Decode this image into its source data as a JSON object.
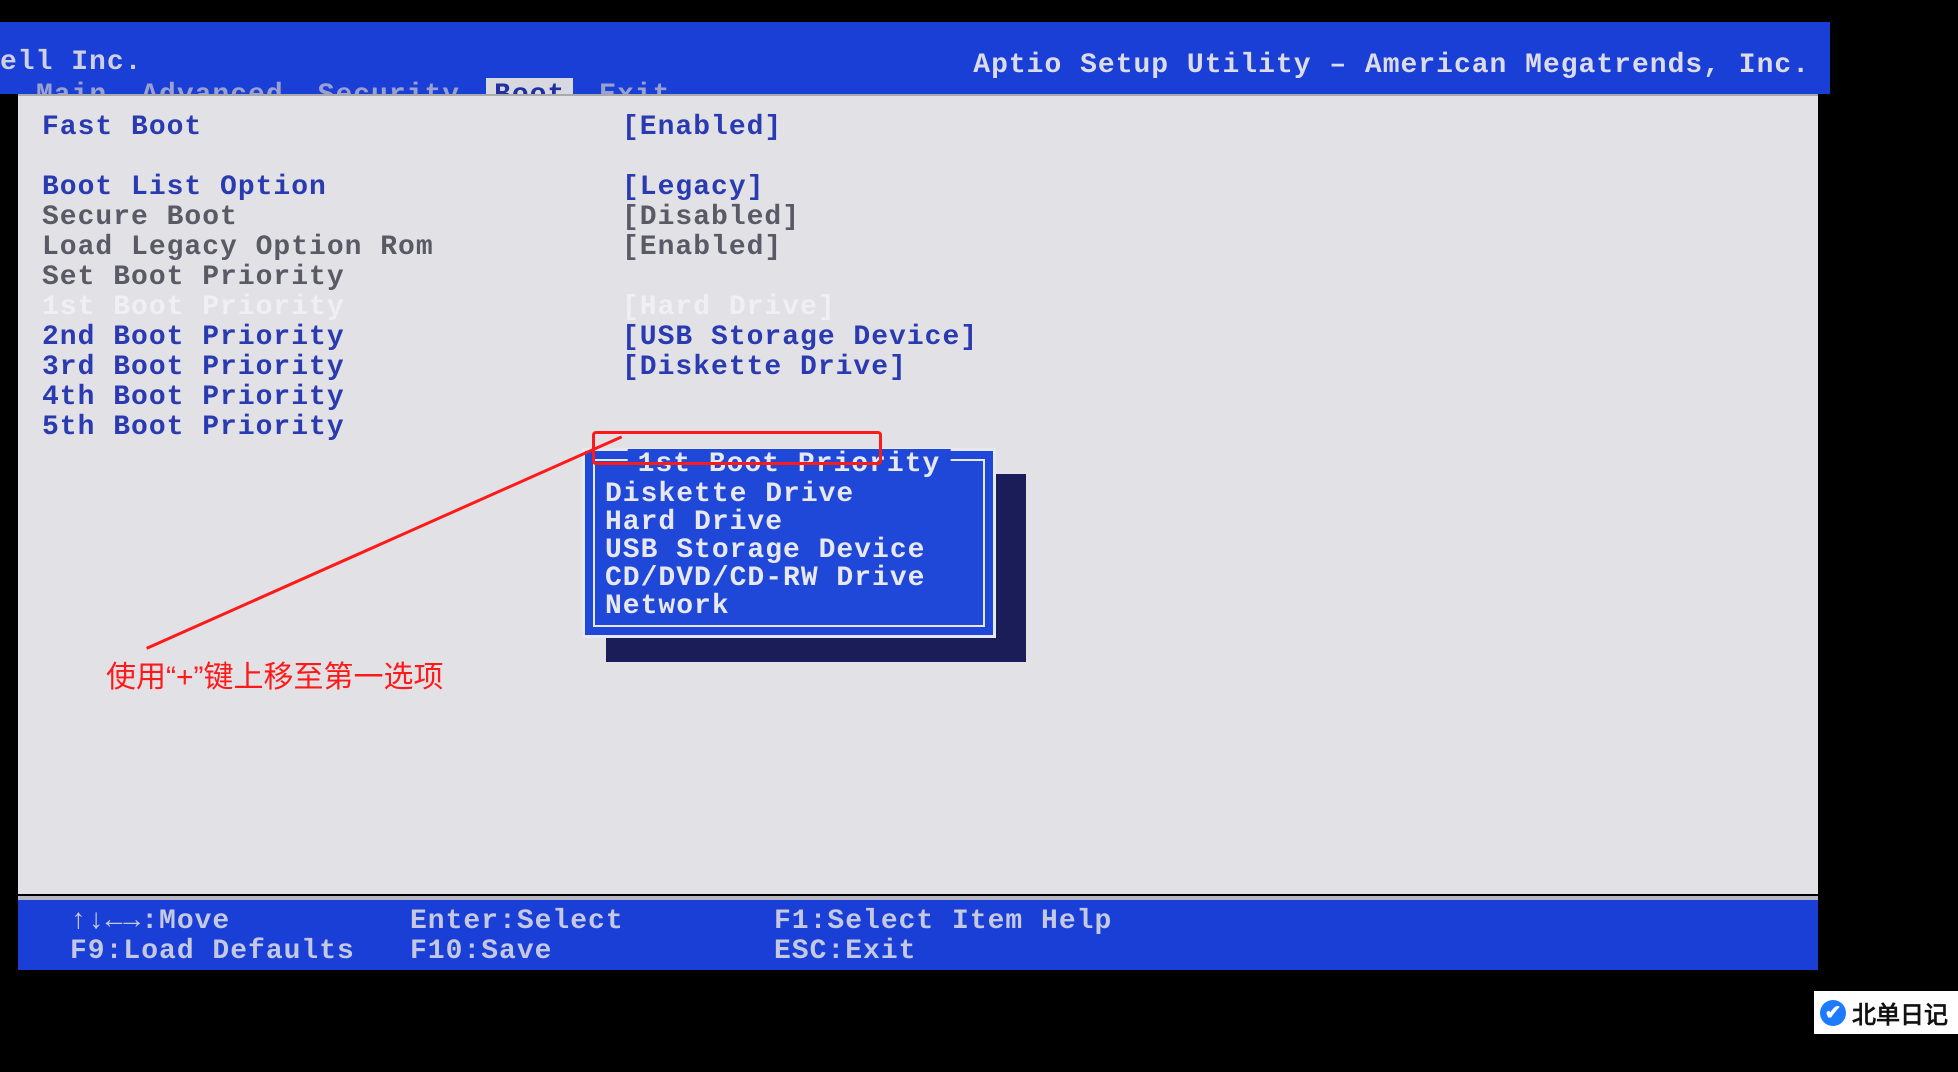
{
  "vendor": "ell Inc.",
  "utility_title": "Aptio Setup Utility – American Megatrends, Inc.",
  "tabs": {
    "main": "Main",
    "advanced": "Advanced",
    "security": "Security",
    "boot": "Boot",
    "exit": "Exit"
  },
  "settings": {
    "fast_boot": {
      "label": "Fast Boot",
      "value": "[Enabled]"
    },
    "boot_list_option": {
      "label": "Boot List Option",
      "value": "[Legacy]"
    },
    "secure_boot": {
      "label": "Secure Boot",
      "value": "[Disabled]"
    },
    "load_legacy_option_rom": {
      "label": "Load Legacy Option Rom",
      "value": "[Enabled]"
    },
    "set_boot_priority": {
      "label": "Set Boot Priority",
      "value": ""
    },
    "p1": {
      "label": "1st Boot Priority",
      "value": "[Hard Drive]"
    },
    "p2": {
      "label": "2nd Boot Priority",
      "value": "[USB Storage Device]"
    },
    "p3": {
      "label": "3rd Boot Priority",
      "value": "[Diskette Drive]"
    },
    "p4": {
      "label": "4th Boot Priority",
      "value": ""
    },
    "p5": {
      "label": "5th Boot Priority",
      "value": ""
    }
  },
  "popup": {
    "title": "1st Boot Priority",
    "items": {
      "a": "Diskette Drive",
      "b": "Hard Drive",
      "c": "USB Storage Device",
      "d": "CD/DVD/CD-RW Drive",
      "e": "Network"
    }
  },
  "annotation_text": "使用“+”键上移至第一选项",
  "footer": {
    "move": "↑↓←→:Move",
    "enter": "Enter:Select",
    "f1": "F1:Select Item Help",
    "f9": "F9:Load Defaults",
    "f10": "F10:Save",
    "esc": "ESC:Exit"
  },
  "watermark": "北单日记"
}
